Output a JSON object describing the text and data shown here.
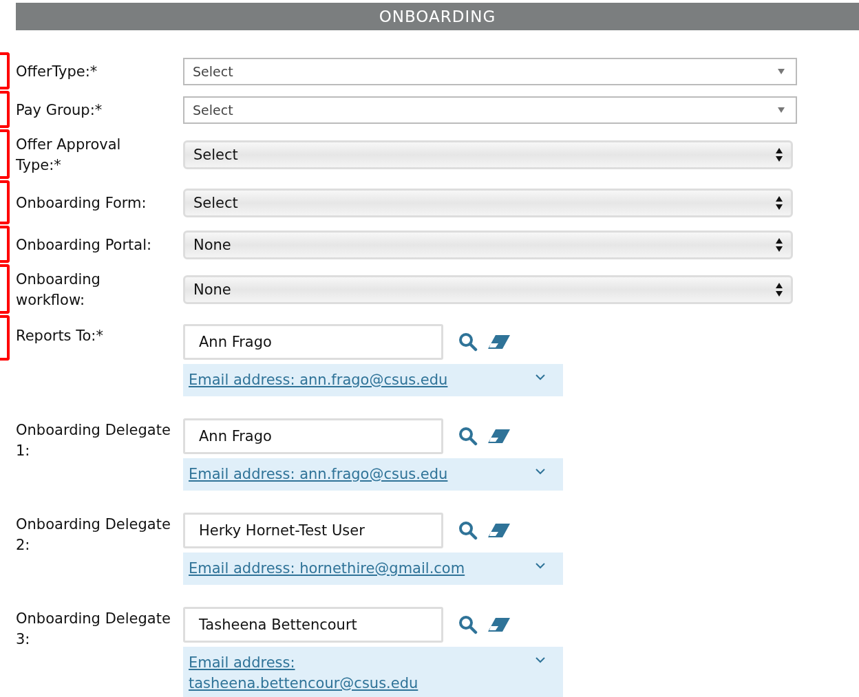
{
  "header": {
    "title": "ONBOARDING"
  },
  "fields": [
    {
      "label": "OfferType:*",
      "kind": "flat",
      "value": "Select",
      "marked": true
    },
    {
      "label": "Pay Group:*",
      "kind": "flat",
      "value": "Select",
      "marked": true
    },
    {
      "label": "Offer Approval Type:*",
      "kind": "pill",
      "value": "Select",
      "marked": true
    },
    {
      "label": "Onboarding Form:",
      "kind": "pill",
      "value": "Select",
      "marked": true
    },
    {
      "label": "Onboarding Portal:",
      "kind": "pill",
      "value": "None",
      "marked": true
    },
    {
      "label": "Onboarding workflow:",
      "kind": "pill",
      "value": "None",
      "marked": true
    }
  ],
  "people": [
    {
      "label": "Reports To:*",
      "name": "Ann Frago",
      "email": "Email address: ann.frago@csus.edu",
      "marked": true
    },
    {
      "label": "Onboarding Delegate 1:",
      "name": "Ann Frago",
      "email": "Email address: ann.frago@csus.edu",
      "marked": false
    },
    {
      "label": "Onboarding Delegate 2:",
      "name": "Herky Hornet-Test User",
      "email": "Email address: hornethire@gmail.com",
      "marked": false
    },
    {
      "label": "Onboarding Delegate 3:",
      "name": "Tasheena Bettencourt",
      "email": "Email address: tasheena.bettencour@csus.edu",
      "marked": false
    }
  ]
}
